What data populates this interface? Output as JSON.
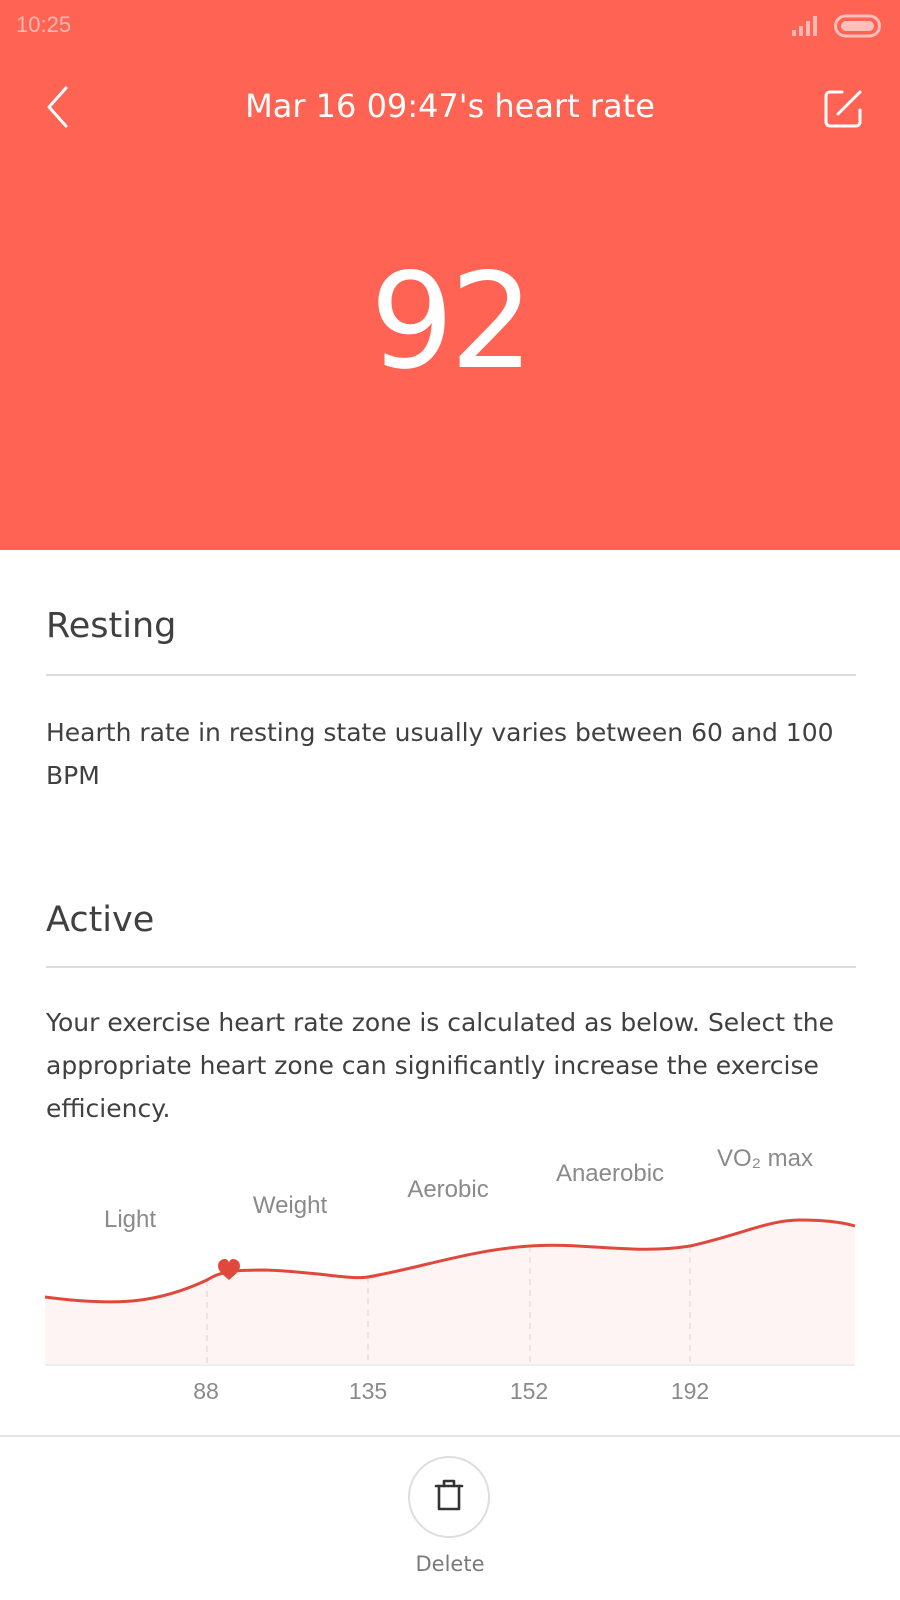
{
  "status_bar": {
    "time": "10:25"
  },
  "header": {
    "title": "Mar 16 09:47's heart rate",
    "value": "92",
    "background_color": "#ff6353",
    "back_icon": "chevron-left-icon",
    "edit_icon": "edit-icon"
  },
  "resting": {
    "title": "Resting",
    "description": "Hearth rate in resting state usually varies between 60 and 100 BPM"
  },
  "active": {
    "title": "Active",
    "description": "Your exercise heart rate zone is calculated as below. Select the appropriate heart zone can significantly increase the exercise efficiency."
  },
  "chart_data": {
    "type": "line",
    "zones": [
      "Light",
      "Weight",
      "Aerobic",
      "Anaerobic",
      "VO₂ max"
    ],
    "boundaries": [
      "88",
      "135",
      "152",
      "192"
    ],
    "current_value": 92,
    "line_color": "#e0483c",
    "marker_color": "#e0483c"
  },
  "footer": {
    "delete_label": "Delete",
    "delete_icon": "trash-icon"
  }
}
